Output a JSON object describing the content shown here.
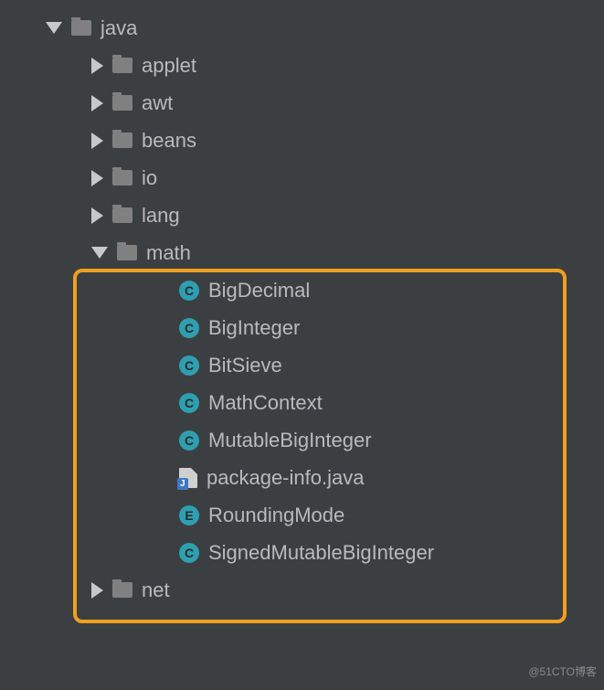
{
  "tree": {
    "root": {
      "label": "java",
      "children": [
        {
          "label": "applet"
        },
        {
          "label": "awt"
        },
        {
          "label": "beans"
        },
        {
          "label": "io"
        },
        {
          "label": "lang"
        },
        {
          "label": "math",
          "highlighted": true,
          "items": [
            {
              "type": "C",
              "label": "BigDecimal"
            },
            {
              "type": "C",
              "label": "BigInteger"
            },
            {
              "type": "C",
              "label": "BitSieve"
            },
            {
              "type": "C",
              "label": "MathContext"
            },
            {
              "type": "C",
              "label": "MutableBigInteger"
            },
            {
              "type": "J",
              "label": "package-info.java"
            },
            {
              "type": "E",
              "label": "RoundingMode"
            },
            {
              "type": "C",
              "label": "SignedMutableBigInteger"
            }
          ]
        },
        {
          "label": "net"
        }
      ]
    }
  },
  "watermark": "@51CTO博客"
}
